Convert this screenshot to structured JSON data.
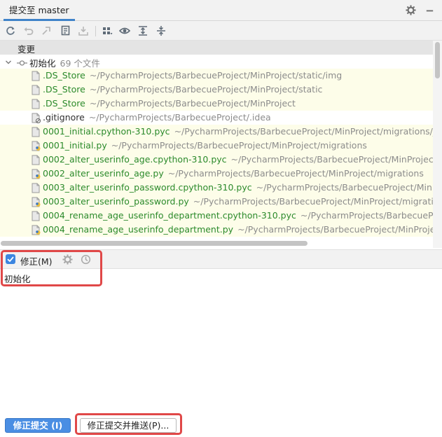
{
  "tab": {
    "title": "提交至 master"
  },
  "header_icons": [
    "gear-icon",
    "minimize-icon"
  ],
  "toolbar": {
    "items": [
      "refresh-icon",
      "undo-icon",
      "revert-icon",
      "show-diff-icon",
      "shelve-icon",
      "group-by-icon",
      "preview-icon",
      "expand-all-icon",
      "collapse-all-icon"
    ]
  },
  "changes": {
    "header": "变更",
    "group": {
      "name": "初始化",
      "count": "69 个文件"
    },
    "files": [
      {
        "name": ".DS_Store",
        "path": "~/PycharmProjects/BarbecueProject/MinProject/static/img",
        "status": "added"
      },
      {
        "name": ".DS_Store",
        "path": "~/PycharmProjects/BarbecueProject/MinProject/static",
        "status": "added"
      },
      {
        "name": ".DS_Store",
        "path": "~/PycharmProjects/BarbecueProject/MinProject",
        "status": "added"
      },
      {
        "name": ".gitignore",
        "path": "~/PycharmProjects/BarbecueProject/.idea",
        "status": "ignored"
      },
      {
        "name": "0001_initial.cpython-310.pyc",
        "path": "~/PycharmProjects/BarbecueProject/MinProject/migrations/__pycache__",
        "status": "added"
      },
      {
        "name": "0001_initial.py",
        "path": "~/PycharmProjects/BarbecueProject/MinProject/migrations",
        "status": "added"
      },
      {
        "name": "0002_alter_userinfo_age.cpython-310.pyc",
        "path": "~/PycharmProjects/BarbecueProject/MinProject/migrations/__pycache__",
        "status": "added"
      },
      {
        "name": "0002_alter_userinfo_age.py",
        "path": "~/PycharmProjects/BarbecueProject/MinProject/migrations",
        "status": "added"
      },
      {
        "name": "0003_alter_userinfo_password.cpython-310.pyc",
        "path": "~/PycharmProjects/BarbecueProject/MinProject/migrations/__pycache__",
        "status": "added"
      },
      {
        "name": "0003_alter_userinfo_password.py",
        "path": "~/PycharmProjects/BarbecueProject/MinProject/migrations",
        "status": "added"
      },
      {
        "name": "0004_rename_age_userinfo_department.cpython-310.pyc",
        "path": "~/PycharmProjects/BarbecueProject/MinProject/migrations/__pycache__",
        "status": "added"
      },
      {
        "name": "0004_rename_age_userinfo_department.py",
        "path": "~/PycharmProjects/BarbecueProject/MinProject/migrations",
        "status": "added"
      }
    ]
  },
  "amend": {
    "label": "修正(M)",
    "checked": true
  },
  "message": {
    "text": "初始化"
  },
  "buttons": {
    "amend_commit": "修正提交 (I)",
    "amend_commit_push": "修正提交并推送(P)..."
  },
  "colors": {
    "accent": "#4a8ee3",
    "added_file": "#2b8a2b",
    "path": "#8c8c8c",
    "highlight_box": "#e04848",
    "row_highlight": "#fdfde9"
  }
}
